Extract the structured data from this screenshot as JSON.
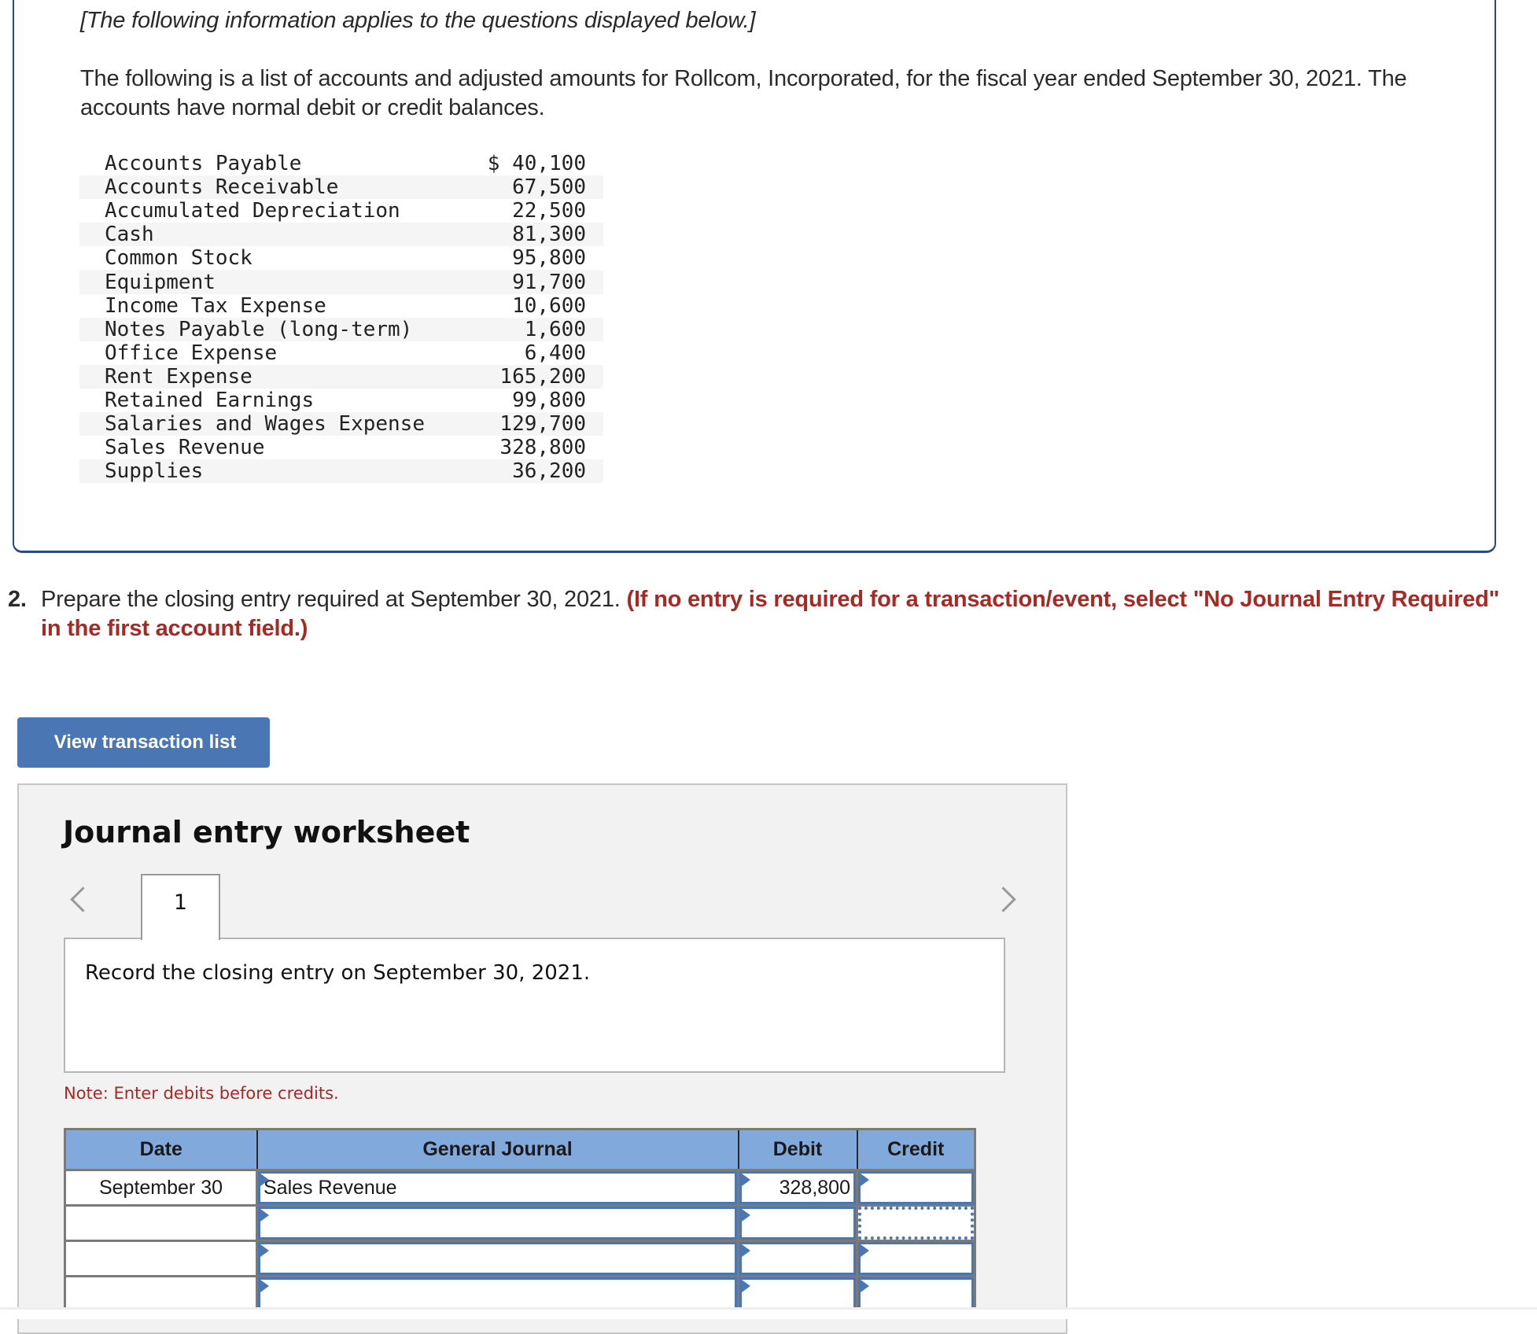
{
  "intro": {
    "italic_note": "[The following information applies to the questions displayed below.]",
    "paragraph": "The following is a list of accounts and adjusted amounts for Rollcom, Incorporated, for the fiscal year ended September 30, 2021. The accounts have normal debit or credit balances."
  },
  "accounts": [
    {
      "name": "Accounts Payable",
      "amount": "$ 40,100"
    },
    {
      "name": "Accounts Receivable",
      "amount": "67,500"
    },
    {
      "name": "Accumulated Depreciation",
      "amount": "22,500"
    },
    {
      "name": "Cash",
      "amount": "81,300"
    },
    {
      "name": "Common Stock",
      "amount": "95,800"
    },
    {
      "name": "Equipment",
      "amount": "91,700"
    },
    {
      "name": "Income Tax Expense",
      "amount": "10,600"
    },
    {
      "name": "Notes Payable (long-term)",
      "amount": "1,600"
    },
    {
      "name": "Office Expense",
      "amount": "6,400"
    },
    {
      "name": "Rent Expense",
      "amount": "165,200"
    },
    {
      "name": "Retained Earnings",
      "amount": "99,800"
    },
    {
      "name": "Salaries and Wages Expense",
      "amount": "129,700"
    },
    {
      "name": "Sales Revenue",
      "amount": "328,800"
    },
    {
      "name": "Supplies",
      "amount": "36,200"
    }
  ],
  "question": {
    "number": "2.",
    "text": "Prepare the closing entry required at September 30, 2021.",
    "instruction": "(If no entry is required for a transaction/event, select \"No Journal Entry Required\" in the first account field.)"
  },
  "buttons": {
    "view_transaction_list": "View transaction list"
  },
  "worksheet": {
    "title": "Journal entry worksheet",
    "tabs": [
      "1"
    ],
    "record_text": "Record the closing entry on September 30, 2021.",
    "note": "Note: Enter debits before credits.",
    "accent_color": "#4a76b4",
    "header_color": "#82a9dc",
    "columns": [
      "Date",
      "General Journal",
      "Debit",
      "Credit"
    ],
    "rows": [
      {
        "date": "September 30",
        "account": "Sales Revenue",
        "debit": "328,800",
        "credit": ""
      },
      {
        "date": "",
        "account": "",
        "debit": "",
        "credit": ""
      },
      {
        "date": "",
        "account": "",
        "debit": "",
        "credit": ""
      },
      {
        "date": "",
        "account": "",
        "debit": "",
        "credit": ""
      }
    ]
  }
}
